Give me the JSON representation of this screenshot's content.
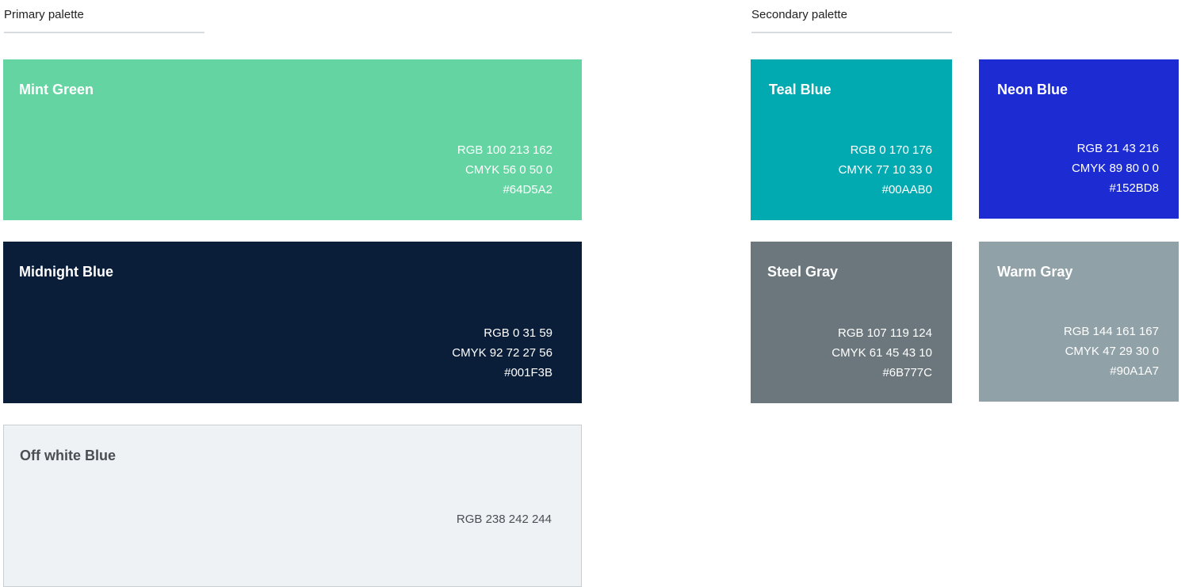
{
  "primary": {
    "title": "Primary palette",
    "swatches": [
      {
        "name": "Mint Green",
        "rgb": "RGB 100 213 162",
        "cmyk": "CMYK 56 0 50 0",
        "hex": "#64D5A2",
        "color": "#64D5A2"
      },
      {
        "name": "Midnight Blue",
        "rgb": "RGB 0 31 59",
        "cmyk": "CMYK  92 72 27 56",
        "hex": "#001F3B",
        "color": "#0A1E3A"
      },
      {
        "name": "Off white Blue",
        "rgb": "RGB 238 242 244",
        "color": "#EEF2F4"
      }
    ]
  },
  "secondary": {
    "title": "Secondary palette",
    "swatches": [
      {
        "name": "Teal Blue",
        "rgb": "RGB 0 170 176",
        "cmyk": "CMYK 77 10 33 0",
        "hex": "#00AAB0",
        "color": "#00AAB0"
      },
      {
        "name": "Neon Blue",
        "rgb": "RGB 21 43 216",
        "cmyk": "CMYK 89 80 0 0",
        "hex": "#152BD8",
        "color": "#1D2BD2"
      },
      {
        "name": "Steel Gray",
        "rgb": "RGB 107 119 124",
        "cmyk": "CMYK 61 45 43 10",
        "hex": "#6B777C",
        "color": "#6B777C"
      },
      {
        "name": "Warm Gray",
        "rgb": "RGB 144 161 167",
        "cmyk": "CMYK 47 29 30 0",
        "hex": "#90A1A7",
        "color": "#90A1A7"
      }
    ]
  }
}
